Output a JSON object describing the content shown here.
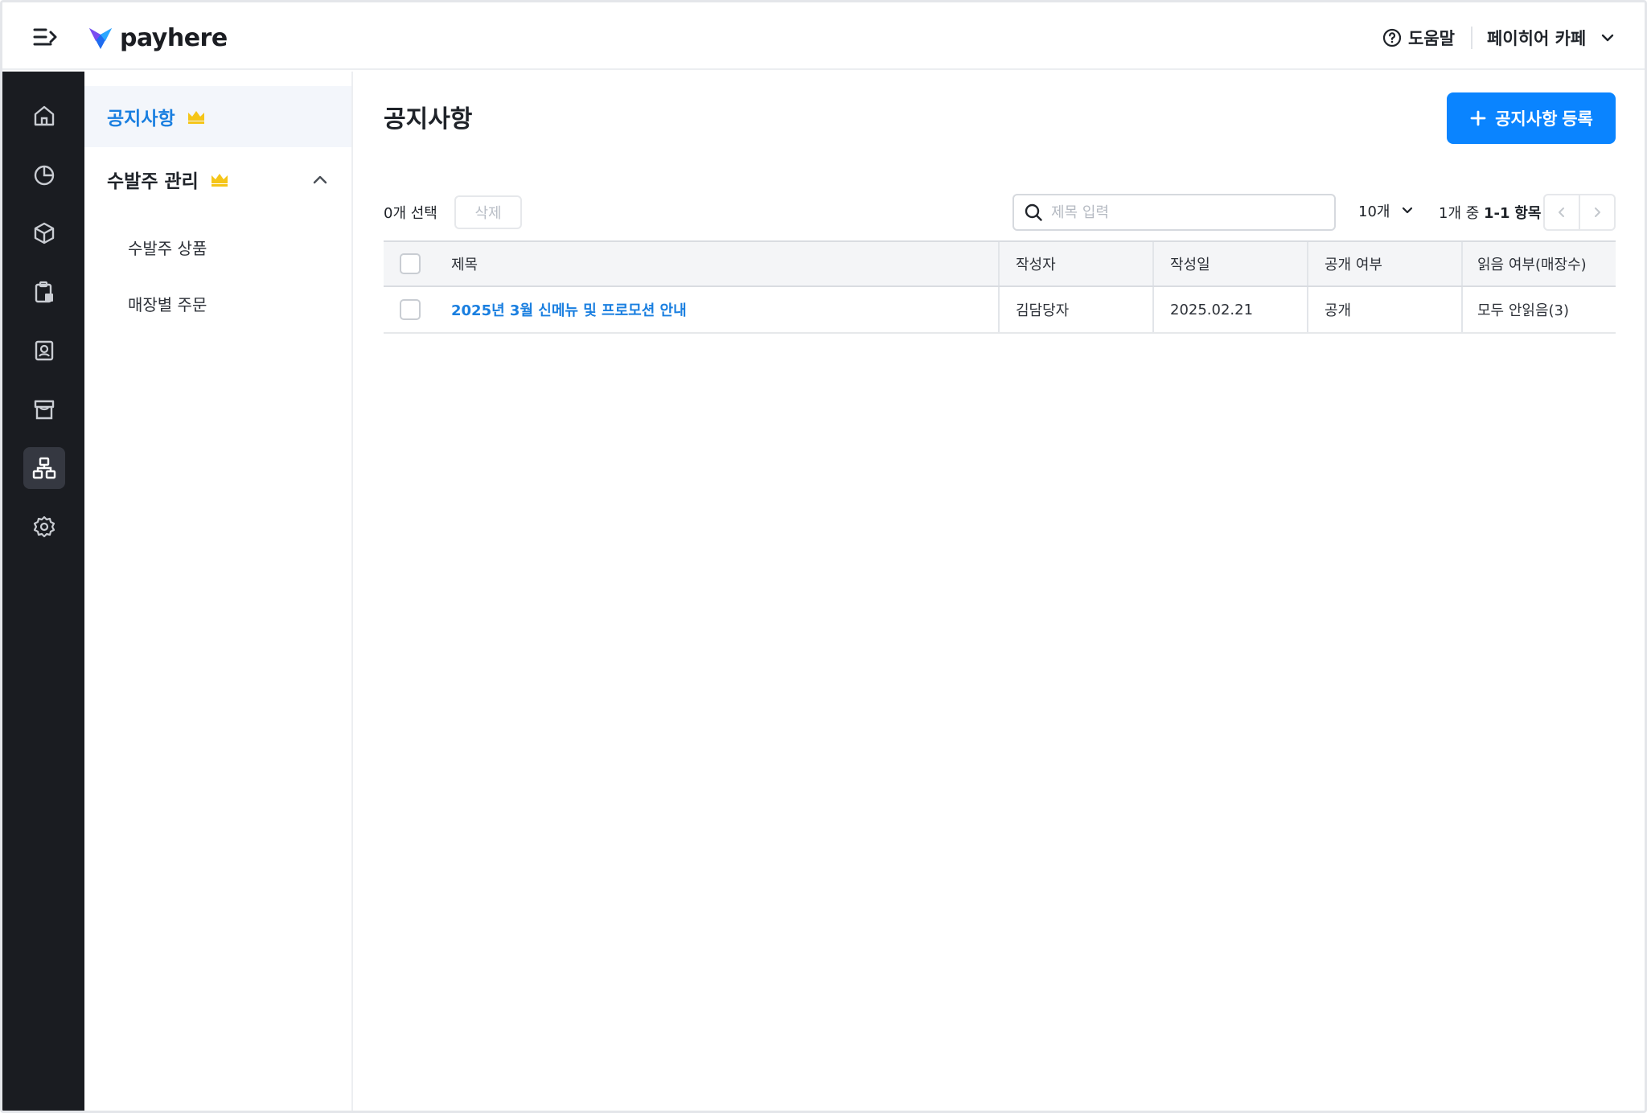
{
  "header": {
    "logo_text": "payhere",
    "help_label": "도움말",
    "store_name": "페이히어 카페"
  },
  "rail": {
    "items": [
      "home-icon",
      "analytics-icon",
      "product-icon",
      "clipboard-icon",
      "customer-icon",
      "store-icon",
      "org-chart-icon",
      "settings-icon"
    ],
    "active": "org-chart-icon"
  },
  "sidebar": {
    "items": [
      {
        "label": "공지사항",
        "active": true,
        "premium": true
      },
      {
        "label": "수발주 관리",
        "active": false,
        "premium": true,
        "expanded": true,
        "children": [
          {
            "label": "수발주 상품"
          },
          {
            "label": "매장별 주문"
          }
        ]
      }
    ]
  },
  "main": {
    "title": "공지사항",
    "add_button_label": "공지사항 등록",
    "selected_count_label": "0개 선택",
    "delete_label": "삭제",
    "search_placeholder": "제목 입력",
    "per_page_label": "10개",
    "range_prefix": "1개 중",
    "range_value": "1-1",
    "range_suffix": "항목"
  },
  "table": {
    "columns": [
      "제목",
      "작성자",
      "작성일",
      "공개 여부",
      "읽음 여부(매장수)"
    ],
    "rows": [
      {
        "title": "2025년 3월 신메뉴 및 프로모션 안내",
        "author": "김담당자",
        "date": "2025.02.21",
        "visibility": "공개",
        "read_status": "모두 안읽음(3)"
      }
    ]
  },
  "colors": {
    "accent": "#0a84ff",
    "rail_bg": "#1a1c21",
    "crown": "#f5c518",
    "link": "#1a7fe0"
  }
}
